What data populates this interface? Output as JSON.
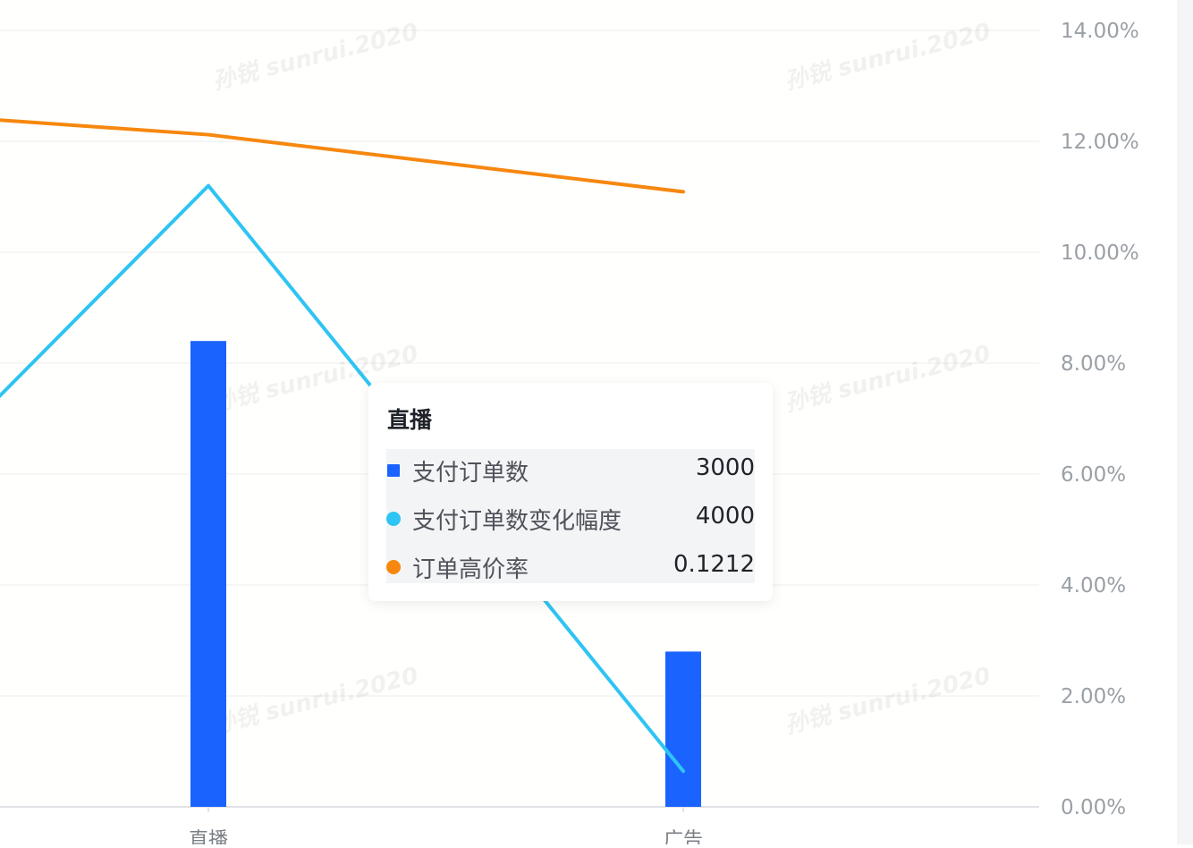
{
  "chart_data": {
    "type": "bar+line",
    "categories": [
      "直播",
      "广告"
    ],
    "series": [
      {
        "name": "支付订单数",
        "type": "bar",
        "axis": "left",
        "color": "#1b63ff",
        "values": [
          3000,
          1000
        ]
      },
      {
        "name": "支付订单数变化幅度",
        "type": "line",
        "axis": "left",
        "color": "#2ec4f3",
        "values": [
          4000,
          230
        ]
      },
      {
        "name": "订单高价率",
        "type": "line",
        "axis": "right",
        "color": "#f7870f",
        "values": [
          0.1212,
          0.1109
        ]
      }
    ],
    "y_right": {
      "ticks": [
        "14.00%",
        "12.00%",
        "10.00%",
        "8.00%",
        "6.00%",
        "4.00%",
        "2.00%",
        "0.00%"
      ],
      "range": [
        0,
        0.14
      ]
    },
    "y_left_range": [
      0,
      5000
    ],
    "grid": true,
    "partial_left_points": {
      "支付订单数变化幅度": 2300,
      "订单高价率": 0.1245
    },
    "tooltip": {
      "title": "直播",
      "rows": [
        {
          "name": "支付订单数",
          "value": "3000",
          "color": "#1b63ff",
          "marker": "square"
        },
        {
          "name": "支付订单数变化幅度",
          "value": "4000",
          "color": "#2ec4f3",
          "marker": "circle"
        },
        {
          "name": "订单高价率",
          "value": "0.1212",
          "color": "#f7870f",
          "marker": "circle"
        }
      ]
    },
    "watermark": "孙锐 sunrui.2020"
  }
}
